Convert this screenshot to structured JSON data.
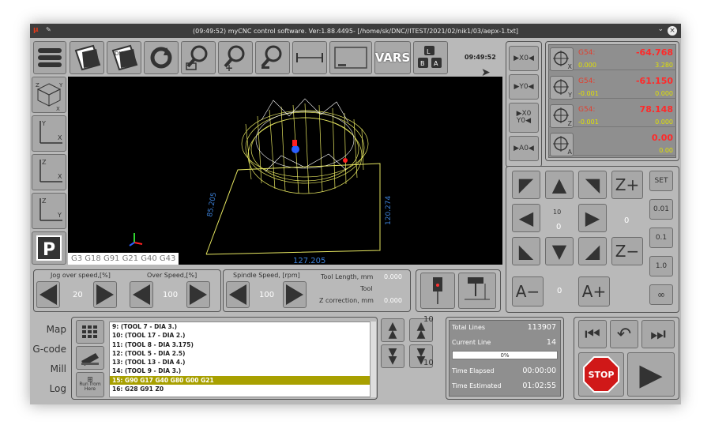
{
  "window": {
    "title": "(09:49:52) myCNC control software. Ver:1.88.4495- [/home/sk/DNC//ITEST/2021/02/nik1/03/aepx-1.txt]"
  },
  "toolbar": {
    "clock": "09:49:52",
    "vars_label": "VARS",
    "icons": [
      "menu-icon",
      "export-icon",
      "dxf-icon",
      "reload-icon",
      "zoom-fit-icon",
      "zoom-in-icon",
      "zoom-out-icon",
      "measure-icon",
      "frame-icon",
      "vars-icon",
      "keyboard-icon"
    ]
  },
  "viewport": {
    "gcodes": "G3  G18  G91  G21  G40  G43",
    "dims": {
      "w": "127.205",
      "h": "120.274",
      "d": "85.205"
    }
  },
  "zero_buttons": [
    "▶X0◀",
    "▶Y0◀",
    "▶X0 Y0◀",
    "▶A0◀"
  ],
  "dro": [
    {
      "axis": "X",
      "label": "G54:",
      "value": "-64.768",
      "sub_left": "0.000",
      "sub_right": "3.280"
    },
    {
      "axis": "Y",
      "label": "G54:",
      "value": "-61.150",
      "sub_left": "-0.001",
      "sub_right": "0.000"
    },
    {
      "axis": "Z",
      "label": "G54:",
      "value": "78.148",
      "sub_left": "-0.001",
      "sub_right": "0.000"
    },
    {
      "axis": "A",
      "label": "",
      "value": "0.00",
      "sub_left": "",
      "sub_right": "0.00"
    }
  ],
  "jog": {
    "step_value": "10",
    "center_value": "0",
    "z_value": "0",
    "a_value": "0",
    "z_plus": "Z+",
    "z_minus": "Z−",
    "a_minus": "A−",
    "a_plus": "A+",
    "side_buttons": [
      "SET",
      "0.01",
      "0.1",
      "1.0",
      "∞"
    ]
  },
  "speeds": {
    "jog_over_label": "Jog over speed,[%]",
    "jog_over_value": "20",
    "over_label": "Over Speed,[%]",
    "over_value": "100",
    "spindle_label": "Spindle Speed, [rpm]",
    "spindle_value": "100",
    "tool_length_label": "Tool Length, mm",
    "tool_length_value": "0.000",
    "tool_label": "Tool",
    "z_corr_label": "Z correction, mm",
    "z_corr_value": "0.000"
  },
  "nav": [
    "Map",
    "G-code",
    "Mill",
    "Log"
  ],
  "gcode_list": [
    "9: (TOOL 7 - DIA 3.)",
    "10: (TOOL 17 - DIA 2.)",
    "11: (TOOL 8 - DIA 3.175)",
    "12: (TOOL 5 - DIA 2.5)",
    "13: (TOOL 13 - DIA 4.)",
    "14: (TOOL 9 - DIA 3.)",
    "15: G90 G17 G40 G80 G00 G21",
    "16: G28 G91 Z0"
  ],
  "selected_line": 6,
  "left_tools": {
    "run_from_here": "Run from Here"
  },
  "step_buttons": {
    "up10": "10",
    "down10": "10"
  },
  "stats": {
    "total_lines_label": "Total Lines",
    "total_lines": "113907",
    "current_line_label": "Current Line",
    "current_line": "14",
    "progress": "0%",
    "time_elapsed_label": "Time Elapsed",
    "time_elapsed": "00:00:00",
    "time_estimated_label": "Time Estimated",
    "time_estimated": "01:02:55"
  },
  "control": {
    "stop_label": "STOP"
  },
  "colors": {
    "stop_red": "#d01818",
    "dro_red": "#ff2a2a",
    "dro_yellow": "#e0e000",
    "selection": "#a8a000"
  }
}
